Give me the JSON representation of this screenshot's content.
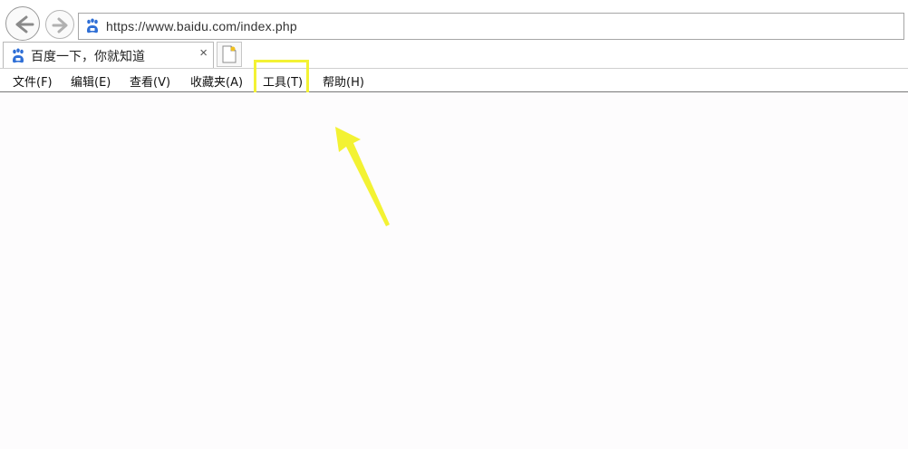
{
  "address_bar": {
    "url": "https://www.baidu.com/index.php",
    "back_icon": "back-arrow-icon",
    "forward_icon": "forward-arrow-icon",
    "site_icon": "baidu-paw-icon"
  },
  "tabs": [
    {
      "title": "百度一下，你就知道",
      "close": "×",
      "active": true
    }
  ],
  "new_tab_icon": "new-tab-icon",
  "menu": {
    "items": [
      {
        "label": "文件(F)"
      },
      {
        "label": "编辑(E)"
      },
      {
        "label": "查看(V)"
      },
      {
        "label": "收藏夹(A)"
      },
      {
        "label": "工具(T)",
        "highlighted": true
      },
      {
        "label": "帮助(H)"
      }
    ]
  },
  "colors": {
    "annotation": "#f3f233",
    "baidu_blue": "#2f6fd6"
  }
}
